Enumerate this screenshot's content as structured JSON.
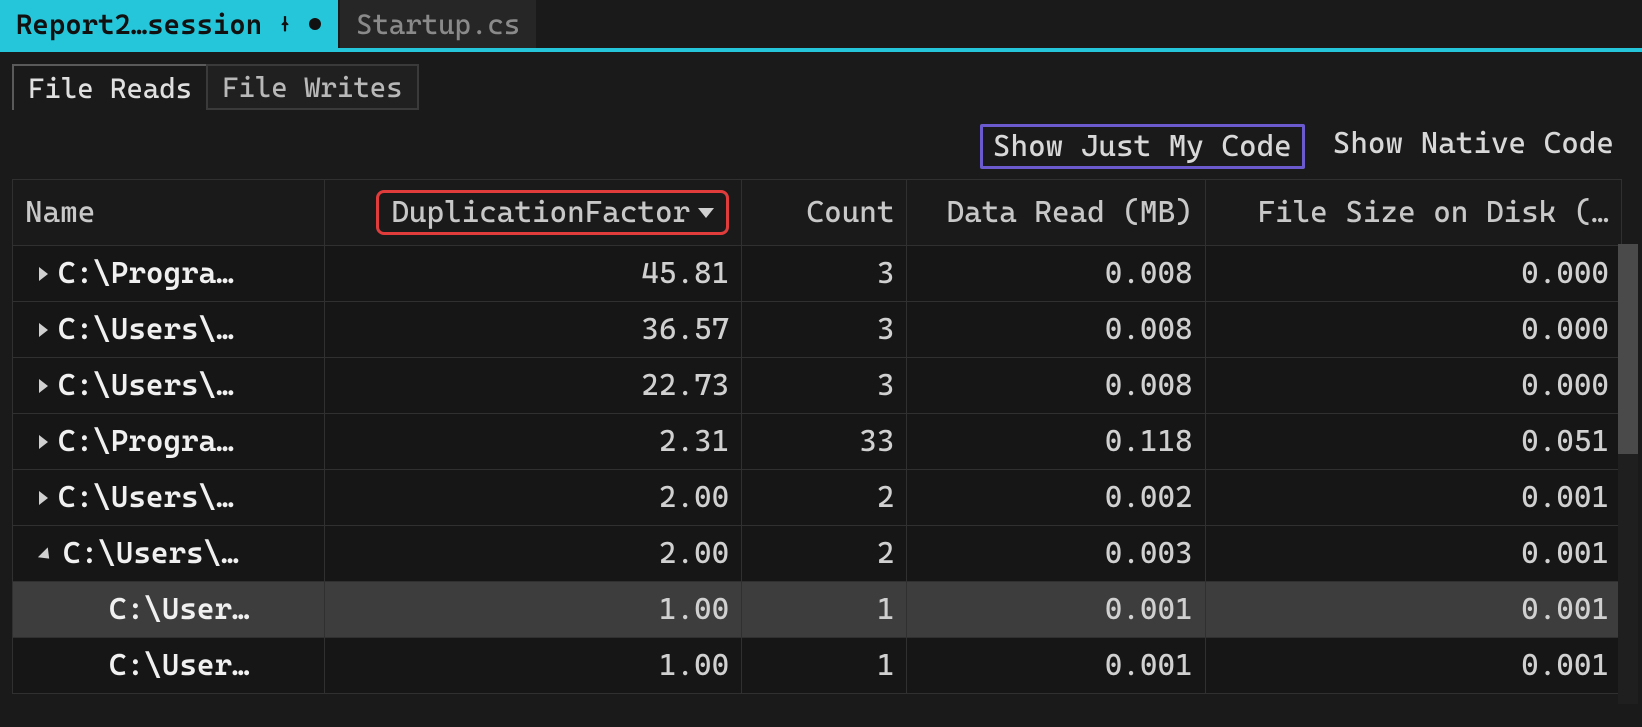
{
  "doc_tabs": {
    "active": {
      "label": "Report2…session"
    },
    "inactive": {
      "label": "Startup.cs"
    }
  },
  "sub_tabs": {
    "reads": "File Reads",
    "writes": "File Writes"
  },
  "filters": {
    "just_my_code": "Show Just My Code",
    "native_code": "Show Native Code"
  },
  "columns": {
    "name": "Name",
    "dup": "DuplicationFactor",
    "count": "Count",
    "read": "Data Read (MB)",
    "size": "File Size on Disk (…"
  },
  "rows": [
    {
      "expand": "collapsed",
      "indent": 1,
      "name": "C:\\Progra…",
      "dup": "45.81",
      "count": "3",
      "read": "0.008",
      "size": "0.000",
      "selected": false
    },
    {
      "expand": "collapsed",
      "indent": 1,
      "name": "C:\\Users\\…",
      "dup": "36.57",
      "count": "3",
      "read": "0.008",
      "size": "0.000",
      "selected": false
    },
    {
      "expand": "collapsed",
      "indent": 1,
      "name": "C:\\Users\\…",
      "dup": "22.73",
      "count": "3",
      "read": "0.008",
      "size": "0.000",
      "selected": false
    },
    {
      "expand": "collapsed",
      "indent": 1,
      "name": "C:\\Progra…",
      "dup": "2.31",
      "count": "33",
      "read": "0.118",
      "size": "0.051",
      "selected": false
    },
    {
      "expand": "collapsed",
      "indent": 1,
      "name": "C:\\Users\\…",
      "dup": "2.00",
      "count": "2",
      "read": "0.002",
      "size": "0.001",
      "selected": false
    },
    {
      "expand": "expanded",
      "indent": 1,
      "name": "C:\\Users\\…",
      "dup": "2.00",
      "count": "2",
      "read": "0.003",
      "size": "0.001",
      "selected": false
    },
    {
      "expand": "none",
      "indent": 2,
      "name": "C:\\User…",
      "dup": "1.00",
      "count": "1",
      "read": "0.001",
      "size": "0.001",
      "selected": true
    },
    {
      "expand": "none",
      "indent": 2,
      "name": "C:\\User…",
      "dup": "1.00",
      "count": "1",
      "read": "0.001",
      "size": "0.001",
      "selected": false
    }
  ]
}
